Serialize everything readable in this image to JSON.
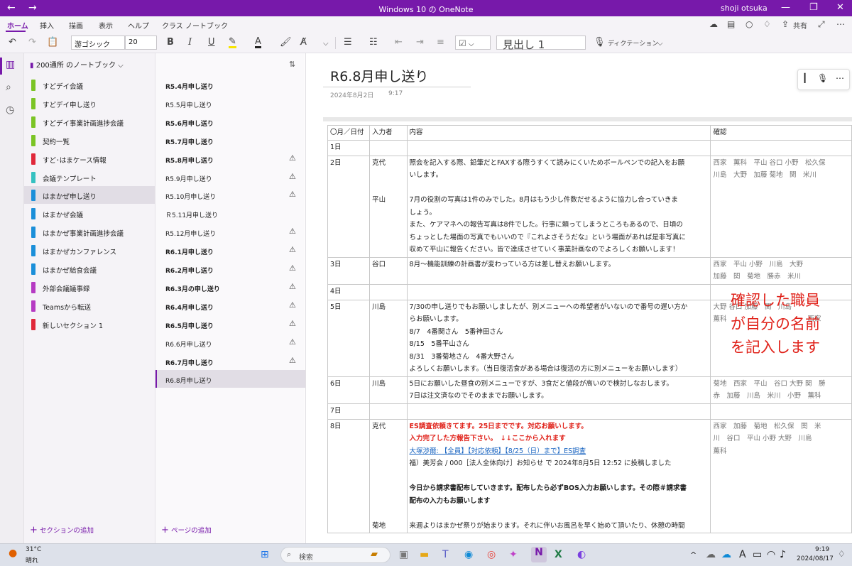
{
  "titlebar": {
    "title": "Windows 10 の OneNote",
    "user": "shoji otsuka",
    "back": "←",
    "forward": "→",
    "minimize": "—",
    "maximize": "❐",
    "close": "✕"
  },
  "ribbon": {
    "tabs": [
      "ホーム",
      "挿入",
      "描画",
      "表示",
      "ヘルプ",
      "クラス ノートブック"
    ],
    "share_label": "共有",
    "font_name": "游ゴシック",
    "font_size": "20",
    "style": "見出し 1",
    "dictation": "ディクテーション"
  },
  "notebook": {
    "name": "200通所 のノートブック"
  },
  "sections": [
    {
      "label": "すどデイ会議",
      "color": "#7bc425"
    },
    {
      "label": "すどデイ申し送り",
      "color": "#7bc425"
    },
    {
      "label": "すどデイ事業計画進捗会議",
      "color": "#7bc425"
    },
    {
      "label": "契約一覧",
      "color": "#7bc425"
    },
    {
      "label": "すど･はまケース情報",
      "color": "#e0283a"
    },
    {
      "label": "会議テンプレート",
      "color": "#36c1c1"
    },
    {
      "label": "はまかぜ申し送り",
      "color": "#1b8fd9"
    },
    {
      "label": "はまかぜ会議",
      "color": "#1b8fd9"
    },
    {
      "label": "はまかぜ事業計画進捗会議",
      "color": "#1b8fd9"
    },
    {
      "label": "はまかぜカンファレンス",
      "color": "#1b8fd9"
    },
    {
      "label": "はまかぜ給食会議",
      "color": "#1b8fd9"
    },
    {
      "label": "外部会議議事録",
      "color": "#b63bc3"
    },
    {
      "label": "Teamsから転送",
      "color": "#b63bc3"
    },
    {
      "label": "新しいセクション 1",
      "color": "#e0283a"
    }
  ],
  "add_section": "セクションの追加",
  "pages": [
    {
      "label": "R5.4月申し送り",
      "bold": true,
      "warn": false
    },
    {
      "label": "R5.5月申し送り",
      "bold": false,
      "warn": false
    },
    {
      "label": "R5.6月申し送り",
      "bold": true,
      "warn": false
    },
    {
      "label": "R5.7月申し送り",
      "bold": true,
      "warn": false
    },
    {
      "label": "R5.8月申し送り",
      "bold": true,
      "warn": true
    },
    {
      "label": "R5.9月申し送り",
      "bold": false,
      "warn": true
    },
    {
      "label": "R5.10月申し送り",
      "bold": false,
      "warn": true
    },
    {
      "label": "Ｒ5.11月申し送り",
      "bold": false,
      "warn": false
    },
    {
      "label": "R5.12月申し送り",
      "bold": false,
      "warn": true
    },
    {
      "label": "R6.1月申し送り",
      "bold": true,
      "warn": true
    },
    {
      "label": "R6.2月申し送り",
      "bold": true,
      "warn": true
    },
    {
      "label": "R6.3月の申し送り",
      "bold": true,
      "warn": true
    },
    {
      "label": "R6.4月申し送り",
      "bold": true,
      "warn": true
    },
    {
      "label": "R6.5月申し送り",
      "bold": true,
      "warn": true
    },
    {
      "label": "R6.6月申し送り",
      "bold": false,
      "warn": true
    },
    {
      "label": "R6.7月申し送り",
      "bold": true,
      "warn": true
    },
    {
      "label": "R6.8月申し送り",
      "bold": false,
      "warn": false
    }
  ],
  "add_page": "ページの追加",
  "page": {
    "title": "R6.8月申し送り",
    "date": "2024年8月2日",
    "time": "9:17",
    "headers": [
      "〇月／日付",
      "入力者",
      "内容",
      "確認"
    ],
    "rows": [
      {
        "date": "1日",
        "blocks": []
      },
      {
        "date": "2日",
        "blocks": [
          {
            "author": "克代",
            "lines": [
              "照会を記入する際、鉛筆だとFAXする際うすくて読みにくいためボールペンでの記入をお願",
              "いします。"
            ]
          },
          {
            "author": "",
            "lines": [
              ""
            ]
          },
          {
            "author": "平山",
            "lines": [
              "7月の役割の写真は1件のみでした。8月はもう少し件数だせるように協力し合っていきま",
              "しょう。",
              "また、ケアマネへの報告写真は8件でした。行事に頼ってしまうところもあるので、日頃の",
              "ちょっとした場面の写真でもいいので『これよさそうだな』という場面があれば是非写真に",
              "収めて平山に報告ください。皆で達成させていく事業計画なのでよろしくお願いします！"
            ]
          }
        ],
        "confirm": [
          "西家　薫科　平山 谷口 小野　松久保",
          "川島　大野　加藤 菊地　関　米川"
        ]
      },
      {
        "date": "3日",
        "blocks": [
          {
            "author": "谷口",
            "lines": [
              "8月～機能訓練の計画書が変わっている方は差し替えお願いします。"
            ]
          }
        ],
        "confirm": [
          " 西家　平山 小野　川島　大野",
          " 加藤　関　菊地　勝赤　米川"
        ]
      },
      {
        "date": "4日",
        "blocks": []
      },
      {
        "date": "5日",
        "blocks": [
          {
            "author": "川島",
            "lines": [
              "7/30の申し送りでもお願いしましたが、別メニューへの希望者がいないので番号の遅い方か",
              "らお願いします。",
              "8/7　4番関さん　5番神田さん",
              "8/15　5番平山さん",
              "8/31　3番菊地さん　4番大野さん",
              "よろしくお願いします。（当日復活食がある場合は復活の方に別メニューをお願いします）"
            ]
          }
        ],
        "confirm": [
          " 大野 谷口 加藤　関　川島",
          "薫科　　　　　　　　　　　　西家"
        ]
      },
      {
        "date": "6日",
        "blocks": [
          {
            "author": "川島",
            "lines": [
              "5日にお願いした昼食の別メニューですが、3食だと値段が高いので検討しなおします。",
              "7日は注文済なのでそのままでお願いします。"
            ]
          }
        ],
        "confirm": [
          "菊地　西家　平山　谷口 大野 関　勝",
          "赤　加藤　川島　米川　小野　薫科"
        ]
      },
      {
        "date": "7日",
        "blocks": []
      },
      {
        "date": "8日",
        "blocks": [
          {
            "author": "克代",
            "lines": [
              "ES調査依頼きてます。25日までです。対応お願いします。",
              "入力完了した方報告下さい。　↓↓ここから入れます",
              "大塚渉爾: 【全員】【対応依頼】【8/25（日）まで】ES調査",
              "福）美芳会 / 000［法人全体向け］お知らせ で 2024年8月5日 12:52 に投稿しました",
              "",
              "今日から請求書配布していきます。配布したら必ずBOS入力お願いします。その際＃請求書",
              "配布の入力もお願いします",
              "",
              "来週よりはまかぜ祭りが始まります。それに伴いお風呂を早く始めて頂いたり、休憩の時間"
            ]
          }
        ],
        "author2": "菊地",
        "confirm": [
          "西家　加藤　菊地　松久保　関　米",
          "川　谷口　平山 小野 大野　川島",
          "薫科"
        ]
      }
    ],
    "ink_note": [
      "確認した職員",
      "が自分の名前",
      "を記入します"
    ]
  },
  "taskbar": {
    "weather_temp": "31°C",
    "weather_desc": "晴れ",
    "search": "検索",
    "time": "9:19",
    "date": "2024/08/17",
    "ime": "A"
  }
}
